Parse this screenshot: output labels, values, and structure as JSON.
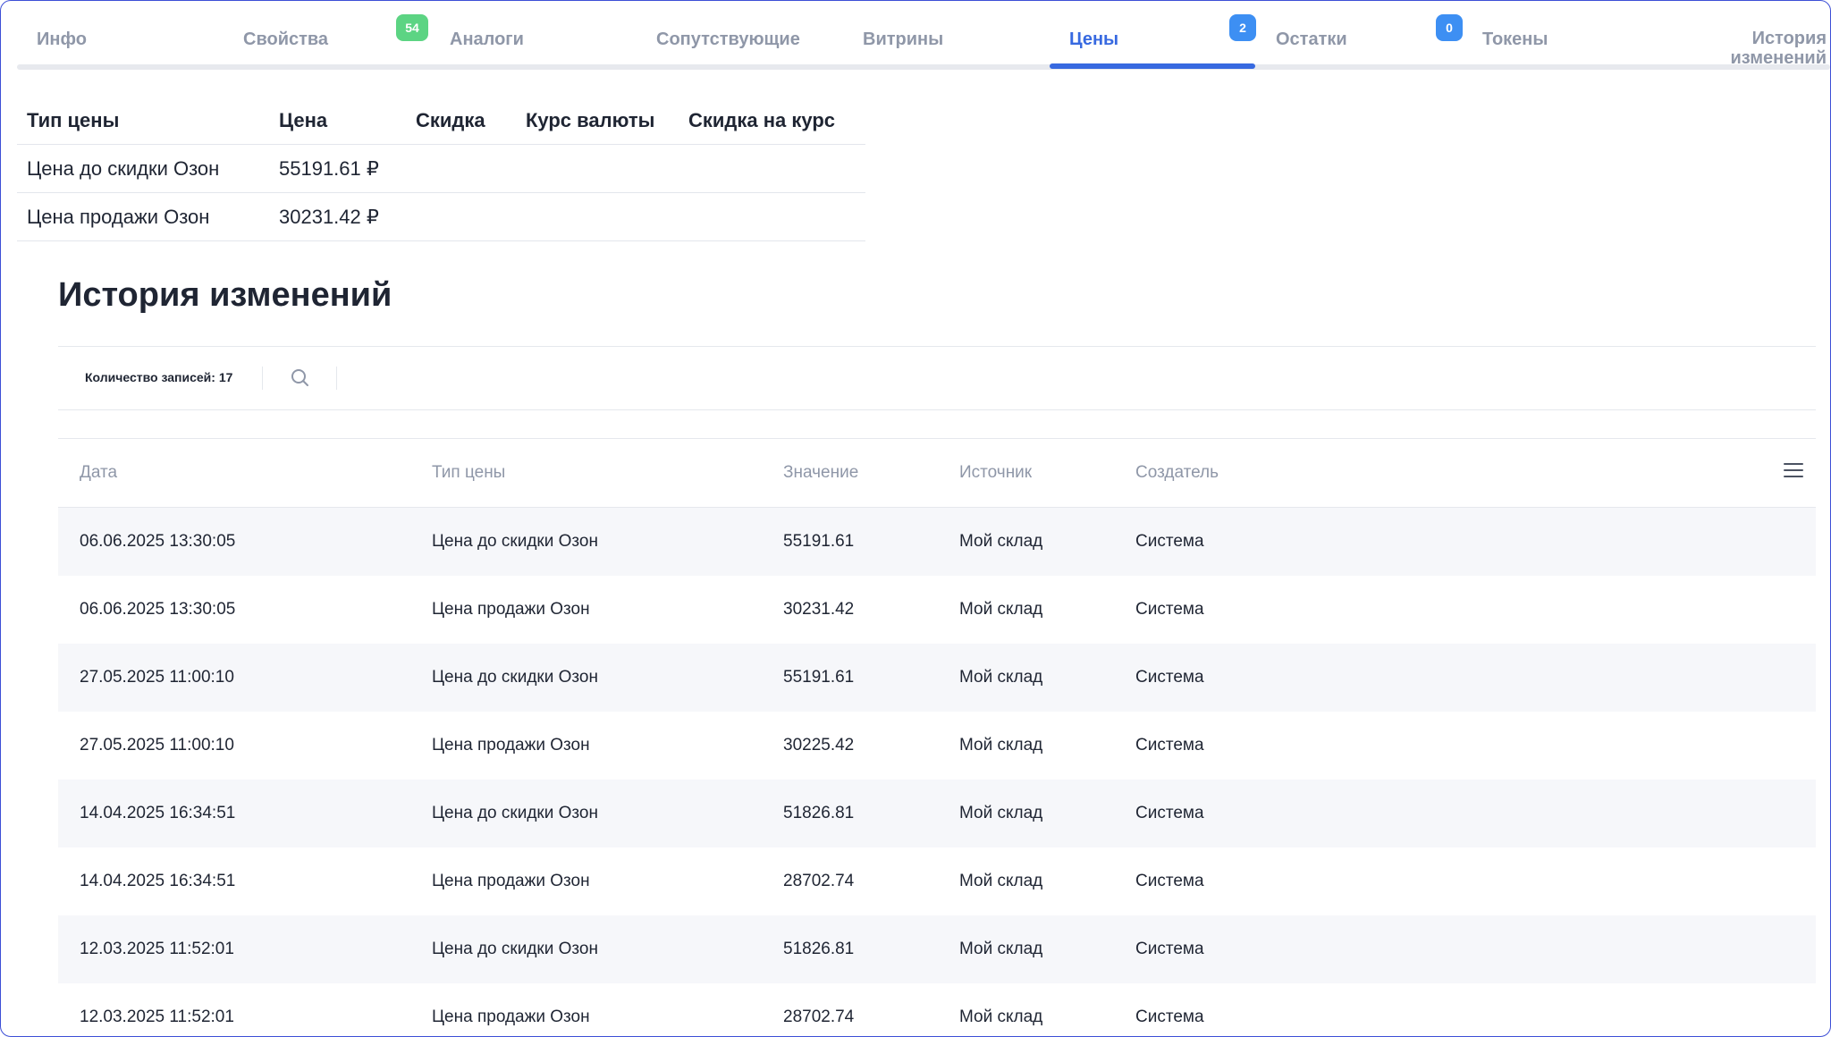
{
  "tabs": [
    {
      "label": "Инфо"
    },
    {
      "label": "Свойства"
    },
    {
      "label": "Аналоги",
      "badge": "54"
    },
    {
      "label": "Сопутствующие"
    },
    {
      "label": "Витрины"
    },
    {
      "label": "Цены",
      "active": true
    },
    {
      "label": "Остатки",
      "badge": "2"
    },
    {
      "label": "Токены",
      "badge": "0"
    },
    {
      "label_line1": "История",
      "label_line2": "изменений"
    }
  ],
  "prices": {
    "headers": [
      "Тип цены",
      "Цена",
      "Скидка",
      "Курс валюты",
      "Скидка на курс"
    ],
    "rows": [
      {
        "type": "Цена до скидки Озон",
        "price": "55191.61 ₽",
        "discount": "",
        "rate": "",
        "rate_discount": ""
      },
      {
        "type": "Цена продажи Озон",
        "price": "30231.42 ₽",
        "discount": "",
        "rate": "",
        "rate_discount": ""
      }
    ]
  },
  "history": {
    "title": "История изменений",
    "count_label": "Количество записей: 17",
    "search_icon": "search-icon",
    "menu_icon": "hamburger-icon",
    "columns": [
      "Дата",
      "Тип цены",
      "Значение",
      "Источник",
      "Создатель"
    ],
    "rows": [
      [
        "06.06.2025 13:30:05",
        "Цена до скидки Озон",
        "55191.61",
        "Мой склад",
        "Система"
      ],
      [
        "06.06.2025 13:30:05",
        "Цена продажи Озон",
        "30231.42",
        "Мой склад",
        "Система"
      ],
      [
        "27.05.2025 11:00:10",
        "Цена до скидки Озон",
        "55191.61",
        "Мой склад",
        "Система"
      ],
      [
        "27.05.2025 11:00:10",
        "Цена продажи Озон",
        "30225.42",
        "Мой склад",
        "Система"
      ],
      [
        "14.04.2025 16:34:51",
        "Цена до скидки Озон",
        "51826.81",
        "Мой склад",
        "Система"
      ],
      [
        "14.04.2025 16:34:51",
        "Цена продажи Озон",
        "28702.74",
        "Мой склад",
        "Система"
      ],
      [
        "12.03.2025 11:52:01",
        "Цена до скидки Озон",
        "51826.81",
        "Мой склад",
        "Система"
      ],
      [
        "12.03.2025 11:52:01",
        "Цена продажи Озон",
        "28702.74",
        "Мой склад",
        "Система"
      ]
    ]
  },
  "colors": {
    "accent": "#3769e0",
    "badge_green": "#5cd483",
    "badge_blue": "#3d8ff3",
    "muted_text": "#8f97a8",
    "stripe": "#f6f7fa"
  }
}
